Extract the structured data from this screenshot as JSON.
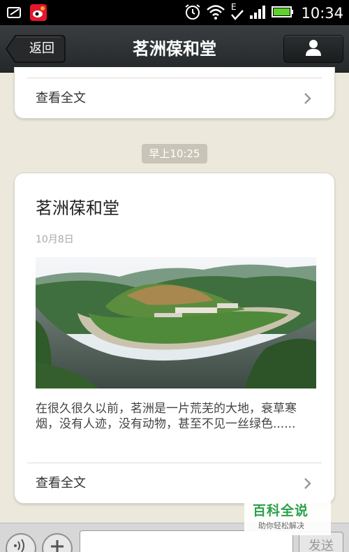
{
  "status_bar": {
    "time": "10:34",
    "icons": [
      "screenshot-icon",
      "weibo-icon",
      "alarm-icon",
      "wifi-icon",
      "edge-signal-icon",
      "cell-signal-icon",
      "battery-icon"
    ]
  },
  "header": {
    "back_label": "返回",
    "title": "茗洲葆和堂",
    "profile_icon": "person-icon"
  },
  "previous_message": {
    "read_more_label": "查看全文"
  },
  "timestamp": "早上10:25",
  "article": {
    "title": "茗洲葆和堂",
    "date": "10月8日",
    "image_description": "river-bend-village-landscape",
    "summary": "在很久很久以前，茗洲是一片荒芜的大地，衰草寒烟，没有人迹，没有动物，甚至不见一丝绿色......",
    "read_more_label": "查看全文"
  },
  "input_bar": {
    "voice_icon": "voice-icon",
    "add_icon": "plus-icon",
    "input_value": "",
    "send_label": "发送"
  },
  "watermark": {
    "title": "百科全说",
    "subtitle": "助你轻松解决"
  },
  "colors": {
    "background": "#ece9dc",
    "titlebar": "#2e3133",
    "watermark_green": "#2aa14a"
  }
}
